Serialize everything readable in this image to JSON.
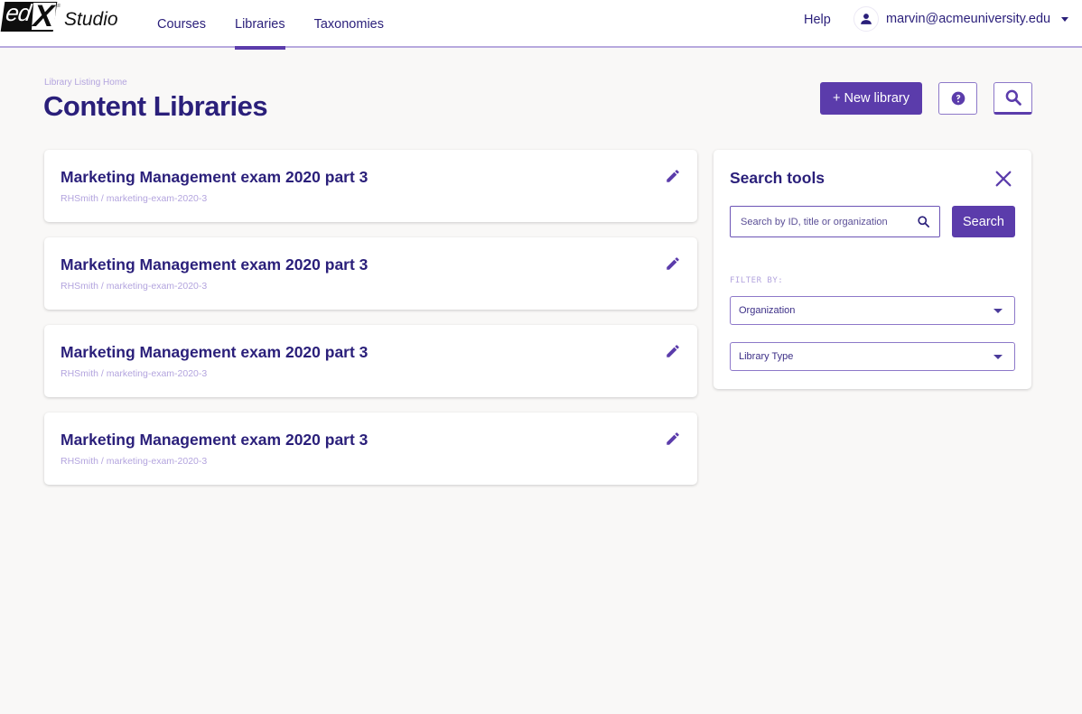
{
  "header": {
    "logo_text": "edX",
    "logo_product": "Studio",
    "nav": [
      {
        "label": "Courses",
        "active": false
      },
      {
        "label": "Libraries",
        "active": true
      },
      {
        "label": "Taxonomies",
        "active": false
      }
    ],
    "help_label": "Help",
    "user_email": "marvin@acmeuniversity.edu",
    "user_icon": "person-icon"
  },
  "page": {
    "breadcrumb": "Library Listing Home",
    "title": "Content Libraries",
    "new_library_label": "+ New library",
    "help_icon": "question-circle-icon",
    "search_icon": "search-icon"
  },
  "libraries": [
    {
      "title": "Marketing Management exam 2020 part 3",
      "subtitle": "RHSmith / marketing-exam-2020-3"
    },
    {
      "title": "Marketing Management exam 2020 part 3",
      "subtitle": "RHSmith / marketing-exam-2020-3"
    },
    {
      "title": "Marketing Management exam 2020 part 3",
      "subtitle": "RHSmith / marketing-exam-2020-3"
    },
    {
      "title": "Marketing Management exam 2020 part 3",
      "subtitle": "RHSmith / marketing-exam-2020-3"
    }
  ],
  "search_tools": {
    "title": "Search tools",
    "input_value": "",
    "input_placeholder": "Search by ID, title or organization",
    "search_button_label": "Search",
    "filter_label": "FILTER BY:",
    "filters": [
      {
        "label": "Organization"
      },
      {
        "label": "Library Type"
      }
    ]
  },
  "colors": {
    "brand": "#5b3cab",
    "text_primary": "#2a1f7a",
    "text_muted": "#b3a4de",
    "background": "#f9f8f7"
  }
}
